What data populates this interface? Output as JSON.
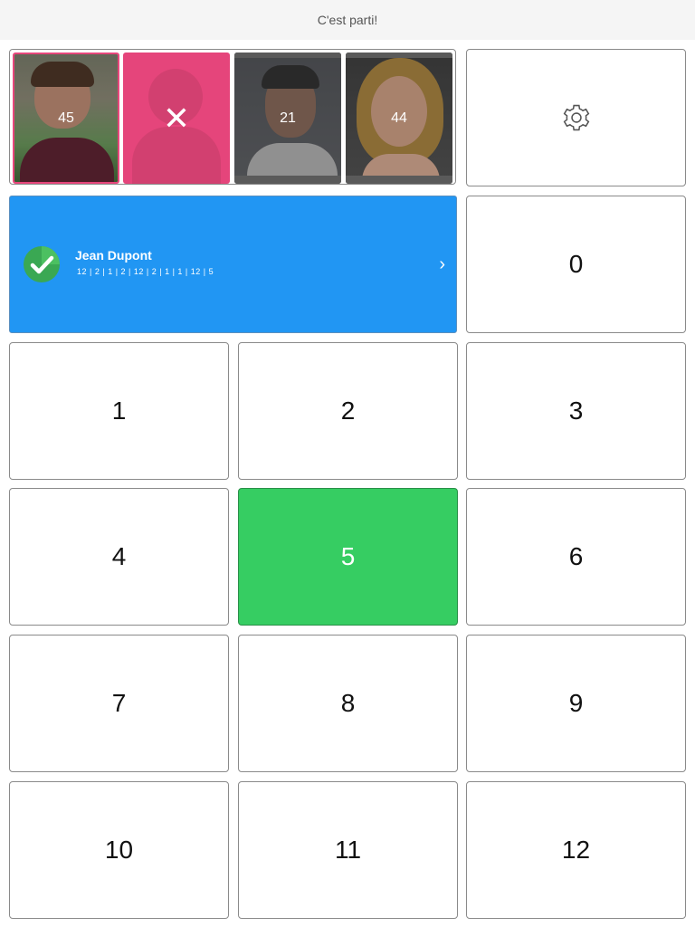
{
  "header": {
    "title": "C'est parti!"
  },
  "players": [
    {
      "number": "45",
      "state": "active"
    },
    {
      "number": "",
      "state": "removed",
      "icon": "close-icon"
    },
    {
      "number": "21",
      "state": "normal"
    },
    {
      "number": "44",
      "state": "normal"
    }
  ],
  "settings": {
    "icon": "gear-icon"
  },
  "current_player": {
    "name": "Jean Dupont",
    "scores": "12 | 2 | 1 | 2 | 12 | 2 | 1 | 1 | 12 | 5",
    "status_icon": "check-icon",
    "chevron": "›"
  },
  "keypad": {
    "k0": "0",
    "k1": "1",
    "k2": "2",
    "k3": "3",
    "k4": "4",
    "k5": "5",
    "k6": "6",
    "k7": "7",
    "k8": "8",
    "k9": "9",
    "k10": "10",
    "k11": "11",
    "k12": "12",
    "selected": "5"
  },
  "colors": {
    "accent_blue": "#2196f3",
    "selected_green": "#36cd62",
    "remove_pink": "#e5457b"
  }
}
